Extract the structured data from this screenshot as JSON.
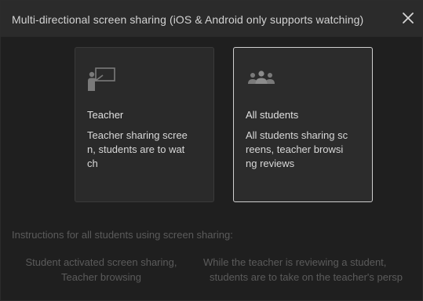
{
  "dialog": {
    "title": "Multi-directional screen sharing (iOS & Android only supports watching)",
    "close_icon": "close-icon"
  },
  "cards": [
    {
      "icon": "teacher-presenting-icon",
      "title": "Teacher",
      "description": "Teacher sharing scree\nn, students are to wat\nch",
      "selected": false
    },
    {
      "icon": "group-of-people-icon",
      "title": "All students",
      "description": "All students sharing sc\nreens, teacher browsi\nng reviews",
      "selected": true
    }
  ],
  "instructions": {
    "heading": "Instructions for all students using screen sharing:",
    "left_line1": "Student activated screen sharing,",
    "left_line2": "Teacher browsing",
    "right_line1": "While the teacher is reviewing a student,",
    "right_line2": "students are to take on the teacher's persp"
  },
  "colors": {
    "background": "#1f1f1f",
    "titlebar": "#2b2b2b",
    "card": "#2a2a2a",
    "selected_border": "#cfcfcf",
    "icon": "#7a7a7a",
    "muted_text": "#5b5b5b"
  }
}
